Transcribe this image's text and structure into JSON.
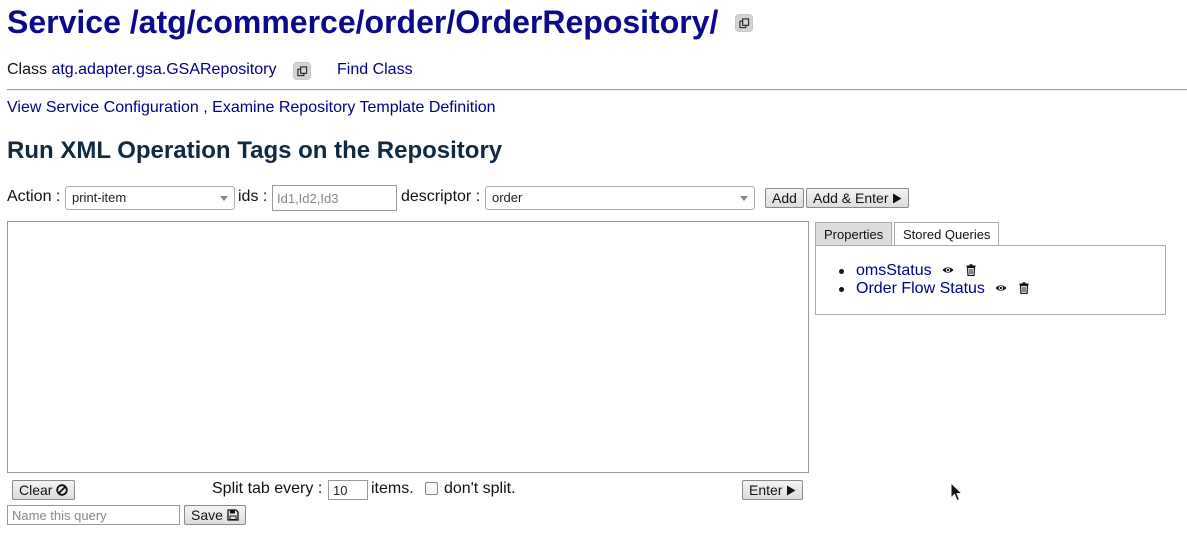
{
  "header": {
    "title": "Service /atg/commerce/order/OrderRepository/",
    "class_prefix": "Class ",
    "class_name": "atg.adapter.gsa.GSARepository",
    "find_class": "Find Class"
  },
  "links": {
    "view_config": "View Service Configuration",
    "separator": " , ",
    "examine_template": "Examine Repository Template Definition"
  },
  "section_heading": "Run XML Operation Tags on the Repository",
  "toolbar": {
    "action_label": "Action :",
    "action_value": "print-item",
    "ids_label": "ids :",
    "ids_placeholder": "Id1,Id2,Id3",
    "descriptor_label": "descriptor :",
    "descriptor_value": "order",
    "add_label": "Add",
    "add_enter_label": "Add & Enter"
  },
  "editor": {
    "value": ""
  },
  "tabs": [
    {
      "label": "Properties",
      "active": false
    },
    {
      "label": "Stored Queries",
      "active": true
    }
  ],
  "stored_queries": [
    {
      "name": "omsStatus"
    },
    {
      "name": "Order Flow Status"
    }
  ],
  "bottom": {
    "clear_label": "Clear",
    "split_prefix": "Split tab every :",
    "split_value": "10",
    "items_label": "items.",
    "dont_split_label": "don't split.",
    "dont_split_checked": false,
    "enter_label": "Enter",
    "query_name_placeholder": "Name this query",
    "save_label": "Save"
  },
  "colors": {
    "title": "#0a0a8a",
    "link": "#00008b",
    "heading": "#102a43"
  },
  "icons": {
    "copy": "copy-icon",
    "play": "play-icon",
    "ban": "ban-icon",
    "eye": "eye-icon",
    "trash": "trash-icon",
    "save": "floppy-icon"
  }
}
